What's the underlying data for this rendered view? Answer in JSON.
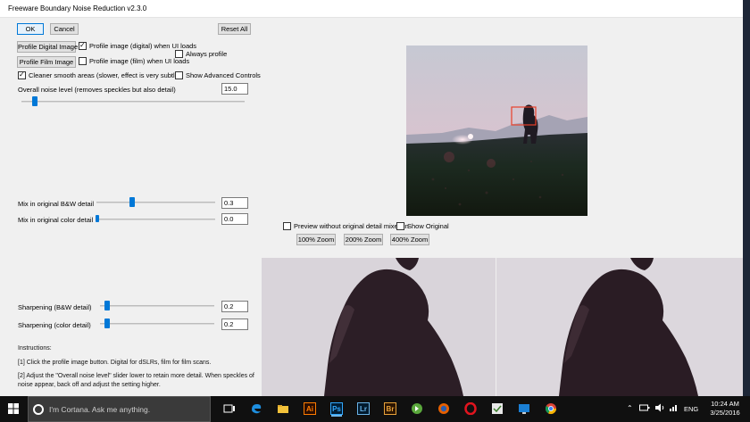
{
  "window": {
    "title": "Freeware Boundary Noise Reduction v2.3.0"
  },
  "buttons": {
    "ok": "OK",
    "cancel": "Cancel",
    "reset_all": "Reset All",
    "profile_digital": "Profile Digital Image",
    "profile_film": "Profile Film Image",
    "zoom100": "100% Zoom",
    "zoom200": "200% Zoom",
    "zoom400": "400% Zoom"
  },
  "checkboxes": {
    "profile_digital_on_load": {
      "label": "Profile image (digital) when UI loads",
      "checked": true
    },
    "profile_film_on_load": {
      "label": "Profile image (film) when UI loads",
      "checked": false
    },
    "always_profile": {
      "label": "Always profile",
      "checked": false
    },
    "cleaner_smooth": {
      "label": "Cleaner smooth areas (slower, effect is very subtle)",
      "checked": true
    },
    "show_advanced": {
      "label": "Show Advanced Controls",
      "checked": false
    },
    "preview_without": {
      "label": "Preview without original detail mixed in",
      "checked": false
    },
    "show_original": {
      "label": "Show Original",
      "checked": false
    }
  },
  "controls": {
    "noise_level": {
      "label": "Overall noise level (removes speckles but also detail)",
      "value": "15.0",
      "fraction": 0.06
    },
    "mix_bw": {
      "label": "Mix in original B&W detail",
      "value": "0.3",
      "fraction": 0.3
    },
    "mix_color": {
      "label": "Mix in original color detail",
      "value": "0.0",
      "fraction": 0.0
    },
    "sharpen_bw": {
      "label": "Sharpening (B&W detail)",
      "value": "0.2",
      "fraction": 0.06
    },
    "sharpen_color": {
      "label": "Sharpening (color detail)",
      "value": "0.2",
      "fraction": 0.06
    }
  },
  "instructions": {
    "heading": "Instructions:",
    "line1": "[1] Click the profile image button.  Digital for dSLRs, film for film scans.",
    "line2a": "[2] Adjust the \"Overall noise level\" slider lower to retain more detail.  When speckles of",
    "line2b": "noise appear, back off and adjust the setting higher."
  },
  "taskbar": {
    "search_placeholder": "I'm Cortana. Ask me anything.",
    "apps": [
      "Ai",
      "Ps",
      "Lr",
      "Br"
    ],
    "lang": "ENG",
    "time": "10:24 AM",
    "date": "3/25/2016"
  },
  "colors": {
    "accent": "#0078d7",
    "title_bg": "#ffffff",
    "dialog_bg": "#f0f0f0",
    "taskbar_bg": "#101010"
  }
}
